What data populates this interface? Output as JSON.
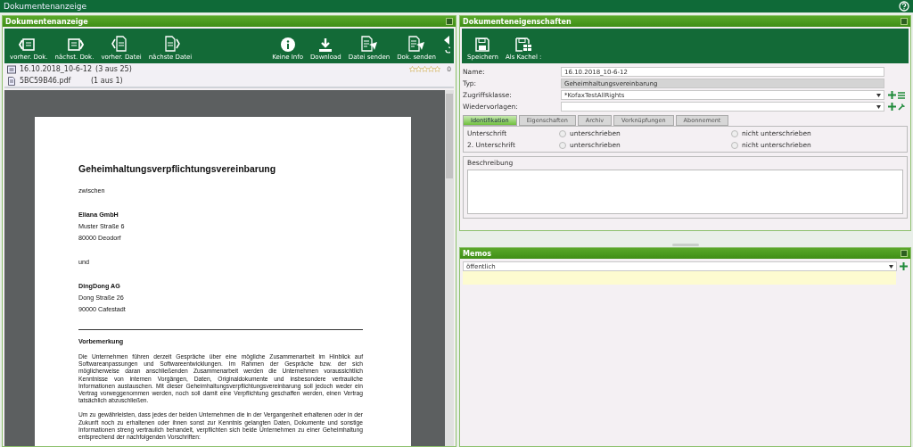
{
  "window": {
    "title": "Dokumentenanzeige"
  },
  "viewer": {
    "title": "Dokumentenanzeige",
    "toolbar": [
      {
        "kind": "prev-doc",
        "label": "vorher. Dok."
      },
      {
        "kind": "next-doc",
        "label": "nächst. Dok."
      },
      {
        "kind": "prev-file",
        "label": "vorher. Datei"
      },
      {
        "kind": "next-file",
        "label": "nächste Datei"
      },
      {
        "kind": "info",
        "label": "Keine Info"
      },
      {
        "kind": "download",
        "label": "Download"
      },
      {
        "kind": "send-file",
        "label": "Datei senden"
      },
      {
        "kind": "send-doc",
        "label": "Dok. senden"
      }
    ],
    "files": [
      {
        "kind": "document",
        "name": "16.10.2018_10-6-12",
        "count": "(3 aus 25)"
      },
      {
        "kind": "pdf",
        "name": "5BC59B46.pdf",
        "count": "(1 aus 1)"
      }
    ],
    "rating": {
      "stars": 0,
      "count": "0"
    },
    "page": {
      "heading": "Geheimhaltungsverpflichtungsvereinbarung",
      "blocks": [
        {
          "kind": "line",
          "text": "zwischen"
        },
        {
          "kind": "address",
          "lines": [
            "Eliana GmbH",
            "Muster Straße 6",
            "80000 Deodorf"
          ]
        },
        {
          "kind": "line",
          "text": "und"
        },
        {
          "kind": "address",
          "lines": [
            "DingDong AG",
            "Dong Straße 26",
            "90000 Cafestadt"
          ]
        },
        {
          "kind": "rule"
        },
        {
          "kind": "subheading",
          "text": "Vorbemerkung"
        },
        {
          "kind": "paragraph",
          "text": "Die Unternehmen führen derzeit Gespräche über eine mögliche Zusammenarbeit im Hinblick auf Softwareanpassungen und Softwareentwicklungen. Im Rahmen der Gespräche bzw. der sich möglicherweise daran anschließenden Zusammenarbeit werden die Unternehmen voraussichtlich Kenntnisse von internen Vorgängen, Daten, Originaldokumente und insbesondere vertrauliche Informationen austauschen. Mit dieser Geheimhaltungsverpflichtungsvereinbarung soll jedoch weder ein Vertrag vorweggenommen werden, noch soll damit eine Verpflichtung geschaffen werden, einen Vertrag tatsächlich abzuschließen."
        },
        {
          "kind": "paragraph",
          "text": "Um zu gewährleisten, dass jedes der beiden Unternehmen die in der Vergangenheit erhaltenen oder in der Zukunft noch zu erhaltenen oder ihnen sonst zur Kenntnis gelangten Daten, Dokumente und sonstige Informationen streng vertraulich behandelt, verpflichten sich beide Unternehmen zu einer Geheimhaltung entsprechend der nachfolgenden Vorschriften:"
        }
      ]
    }
  },
  "properties": {
    "title": "Dokumenteneigenschaften",
    "toolbar": [
      {
        "kind": "save",
        "label": "Speichern"
      },
      {
        "kind": "tile",
        "label": "Als Kachel :"
      }
    ],
    "fields": [
      {
        "kind": "text",
        "label": "Name:",
        "value": "16.10.2018_10-6-12"
      },
      {
        "kind": "readonly",
        "label": "Typ:",
        "value": "Geheimhaltungsvereinbarung"
      },
      {
        "kind": "select-list",
        "label": "Zugriffsklasse:",
        "value": "*KofaxTestAllRights"
      },
      {
        "kind": "select-tool",
        "label": "Wiedervorlagen:"
      }
    ],
    "tabs": [
      {
        "label": "Identifikation",
        "selected": true
      },
      {
        "label": "Eigenschaften",
        "selected": false
      },
      {
        "label": "Archiv",
        "selected": false
      },
      {
        "label": "Verknüpfungen",
        "selected": false
      },
      {
        "label": "Abonnement",
        "selected": false
      }
    ],
    "radio_rows": [
      {
        "label": "Unterschrift",
        "options": [
          {
            "label": "unterschrieben",
            "selected": false
          },
          {
            "label": "nicht unterschrieben",
            "selected": false
          }
        ]
      },
      {
        "label": "2. Unterschrift",
        "options": [
          {
            "label": "unterschrieben",
            "selected": false
          },
          {
            "label": "nicht unterschrieben",
            "selected": false
          }
        ]
      }
    ],
    "description": {
      "label": "Beschreibung"
    }
  },
  "memos": {
    "title": "Memos",
    "visibility": "öffentlich"
  }
}
